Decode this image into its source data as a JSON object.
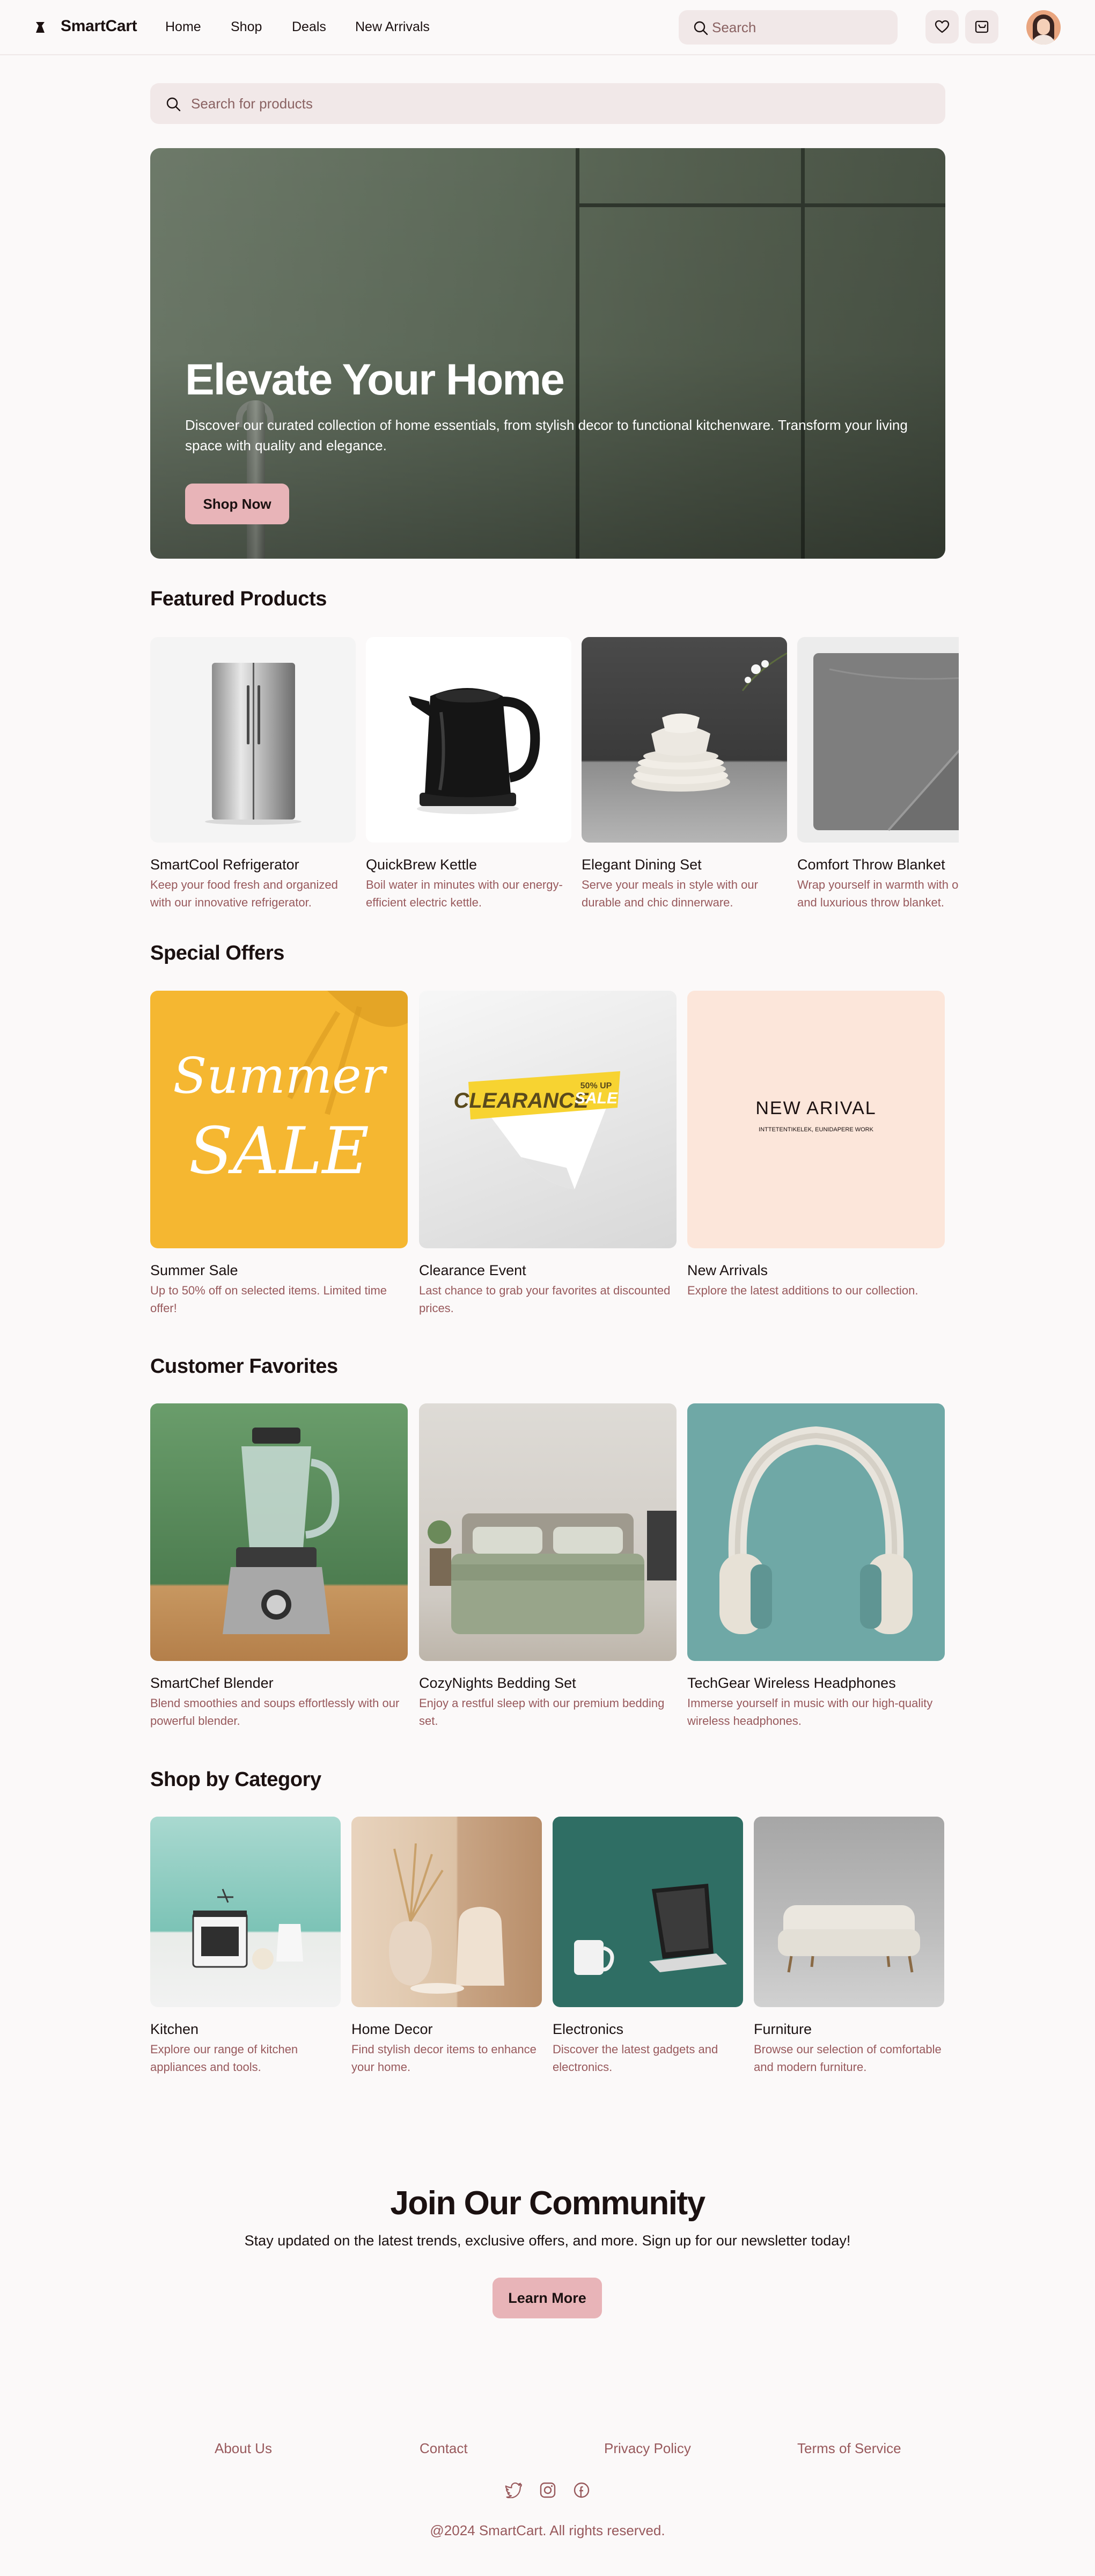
{
  "header": {
    "brand": "SmartCart",
    "nav": [
      "Home",
      "Shop",
      "Deals",
      "New Arrivals"
    ],
    "search_placeholder": "Search"
  },
  "main_search": {
    "placeholder": "Search for products"
  },
  "hero": {
    "title": "Elevate Your Home",
    "subtitle": "Discover our curated collection of home essentials, from stylish decor to functional kitchenware. Transform your living space with quality and elegance.",
    "button": "Shop Now"
  },
  "featured": {
    "title": "Featured Products",
    "items": [
      {
        "name": "SmartCool Refrigerator",
        "desc": "Keep your food fresh and organized with our innovative refrigerator."
      },
      {
        "name": "QuickBrew Kettle",
        "desc": "Boil water in minutes with our energy-efficient electric kettle."
      },
      {
        "name": "Elegant Dining Set",
        "desc": "Serve your meals in style with our durable and chic dinnerware."
      },
      {
        "name": "Comfort Throw Blanket",
        "desc": "Wrap yourself in warmth with our soft and luxurious throw blanket."
      }
    ]
  },
  "offers": {
    "title": "Special Offers",
    "items": [
      {
        "name": "Summer Sale",
        "desc": "Up to 50% off on selected items. Limited time offer!",
        "art_line1": "Summer",
        "art_line2": "SALE"
      },
      {
        "name": "Clearance Event",
        "desc": "Last chance to grab your favorites at discounted prices.",
        "art_main": "CLEARANCE",
        "art_tag": "50% UP",
        "art_sale": "SALE"
      },
      {
        "name": "New Arrivals",
        "desc": "Explore the latest additions to our collection.",
        "art_title": "NEW ARIVAL",
        "art_small": "INTTETENTIKELEK, EUNIDAPERE WORK"
      }
    ]
  },
  "favorites": {
    "title": "Customer Favorites",
    "items": [
      {
        "name": "SmartChef Blender",
        "desc": "Blend smoothies and soups effortlessly with our powerful blender."
      },
      {
        "name": "CozyNights Bedding Set",
        "desc": "Enjoy a restful sleep with our premium bedding set."
      },
      {
        "name": "TechGear Wireless Headphones",
        "desc": "Immerse yourself in music with our high-quality wireless headphones."
      }
    ]
  },
  "categories": {
    "title": "Shop by Category",
    "items": [
      {
        "name": "Kitchen",
        "desc": "Explore our range of kitchen appliances and tools."
      },
      {
        "name": "Home Decor",
        "desc": "Find stylish decor items to enhance your home."
      },
      {
        "name": "Electronics",
        "desc": "Discover the latest gadgets and electronics."
      },
      {
        "name": "Furniture",
        "desc": "Browse our selection of comfortable and modern furniture."
      }
    ]
  },
  "community": {
    "title": "Join Our Community",
    "subtitle": "Stay updated on the latest trends, exclusive offers, and more. Sign up for our newsletter today!",
    "button": "Learn More"
  },
  "footer": {
    "links": [
      "About Us",
      "Contact",
      "Privacy Policy",
      "Terms of Service"
    ],
    "social_icons": [
      "twitter-icon",
      "instagram-icon",
      "facebook-icon"
    ],
    "copyright": "@2024 SmartCart. All rights reserved."
  },
  "colors": {
    "background": "#fbf9f9",
    "accent": "#e8b4b8",
    "muted_text": "#98595c",
    "input_bg": "#f1e8e8"
  }
}
